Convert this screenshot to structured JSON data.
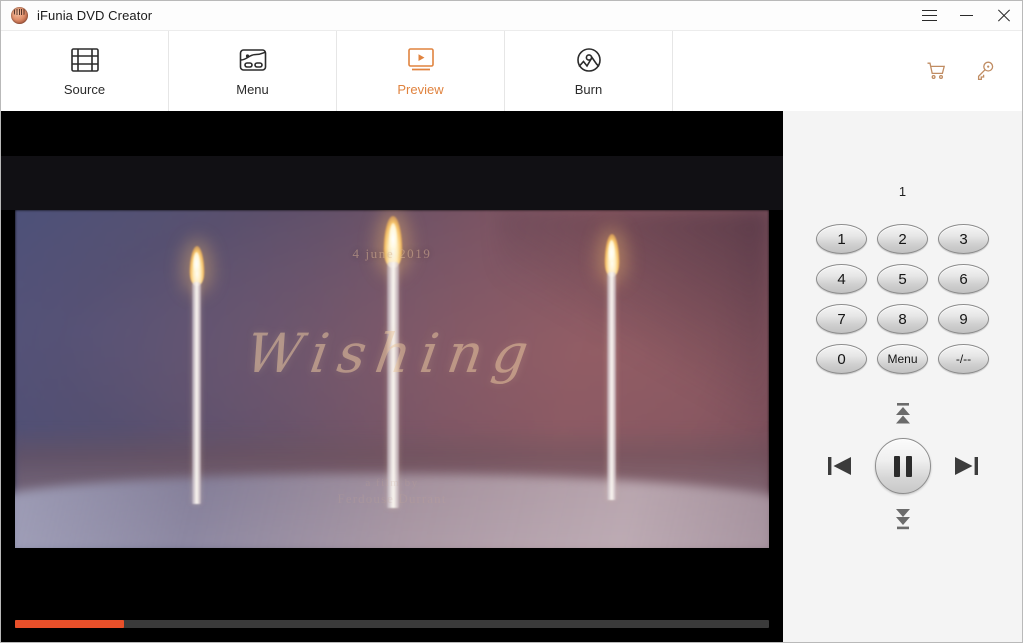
{
  "window": {
    "title": "iFunia DVD Creator",
    "logo_icon": "app-logo-icon",
    "controls": [
      {
        "name": "menu-button",
        "icon": "hamburger-icon"
      },
      {
        "name": "minimize-button",
        "icon": "minimize-icon"
      },
      {
        "name": "close-button",
        "icon": "close-icon"
      }
    ]
  },
  "toolbar": {
    "active_tab": "Preview",
    "accent_color": "#e0833f",
    "tabs": [
      {
        "label": "Source",
        "icon": "film-strip-icon",
        "active": false
      },
      {
        "label": "Menu",
        "icon": "dvd-menu-icon",
        "active": false
      },
      {
        "label": "Preview",
        "icon": "monitor-play-icon",
        "active": true
      },
      {
        "label": "Burn",
        "icon": "burn-disc-icon",
        "active": false
      }
    ],
    "right_icons": [
      {
        "name": "cart-icon",
        "label": "Buy"
      },
      {
        "name": "key-icon",
        "label": "Register"
      }
    ]
  },
  "player": {
    "overlay": {
      "date": "4 june 2019",
      "title": "Wishing",
      "credit_line1": "a film by",
      "credit_line2": "Ferdouse Durrant"
    },
    "progress": {
      "percent": 14.5,
      "fill_color": "#e8502a",
      "track_color": "#3a3a3a"
    }
  },
  "remote": {
    "display": "1",
    "keys": [
      {
        "label": "1",
        "name": "key-1"
      },
      {
        "label": "2",
        "name": "key-2"
      },
      {
        "label": "3",
        "name": "key-3"
      },
      {
        "label": "4",
        "name": "key-4"
      },
      {
        "label": "5",
        "name": "key-5"
      },
      {
        "label": "6",
        "name": "key-6"
      },
      {
        "label": "7",
        "name": "key-7"
      },
      {
        "label": "8",
        "name": "key-8"
      },
      {
        "label": "9",
        "name": "key-9"
      },
      {
        "label": "0",
        "name": "key-0"
      },
      {
        "label": "Menu",
        "name": "key-menu"
      },
      {
        "label": "-/--",
        "name": "key-dash"
      }
    ],
    "transport": {
      "up": "skip-up-icon",
      "previous": "previous-track-icon",
      "pause": "pause-icon",
      "next": "next-track-icon",
      "down": "skip-down-icon"
    }
  }
}
